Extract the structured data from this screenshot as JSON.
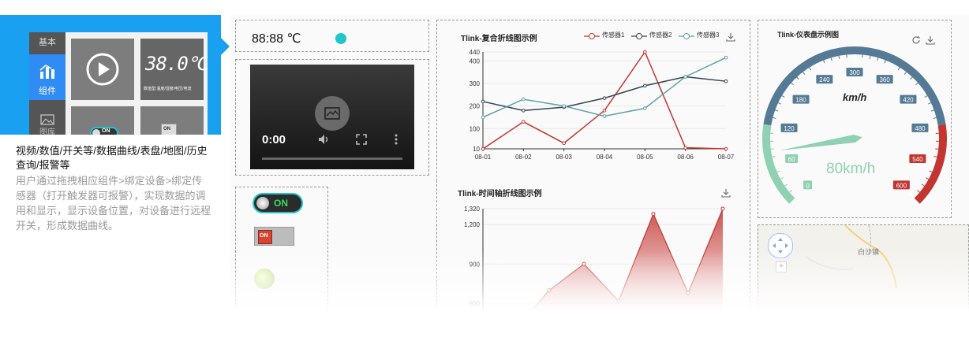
{
  "palette": {
    "tab_basic": "基本",
    "tab_components": "组件",
    "tab_images": "图库",
    "tile_digital_value": "38.0℃",
    "tile_digital_caption": "数值型:温度/湿度/电压/电流",
    "tile_switch_label": "ON",
    "tile_toggle_label": "ON"
  },
  "description": {
    "title": "视频/数值/开关等/数据曲线/表盘/地图/历史查询/报警等",
    "body": "用户通过拖拽相应组件>绑定设备>绑定传感器（打开触发器可报警），实现数据的调用和显示，显示设备位置，对设备进行远程开关，形成数据曲线。"
  },
  "temperature_widget": {
    "value": "88:88 ℃",
    "indicator_color": "#1fc6cc"
  },
  "video_player": {
    "time": "0:00"
  },
  "switch_widget": {
    "label": "ON"
  },
  "red_switch": {
    "label": "ON"
  },
  "chart_data": [
    {
      "type": "line",
      "title": "Tlink-复合折线图示例",
      "categories": [
        "08-01",
        "08-02",
        "08-03",
        "08-04",
        "08-05",
        "08-06",
        "08-07"
      ],
      "series": [
        {
          "name": "传感器1",
          "color": "#c23531",
          "values": [
            10,
            130,
            35,
            180,
            440,
            15,
            10
          ]
        },
        {
          "name": "传感器2",
          "color": "#2f4554",
          "values": [
            220,
            180,
            195,
            235,
            290,
            330,
            310
          ]
        },
        {
          "name": "传感器3",
          "color": "#61a0a8",
          "values": [
            150,
            230,
            200,
            155,
            190,
            330,
            415
          ]
        }
      ],
      "yticks": [
        10,
        100,
        200,
        300,
        400,
        440
      ],
      "ylim": [
        10,
        440
      ]
    },
    {
      "type": "area",
      "title": "Tlink-时间轴折线图示例",
      "series": [
        {
          "name": "",
          "color": "#c23531",
          "values": [
            400,
            700,
            900,
            620,
            1280,
            680,
            1320
          ]
        }
      ],
      "yticks": [
        600,
        900,
        1200,
        1320
      ],
      "ylim": [
        400,
        1320
      ]
    }
  ],
  "gauge": {
    "title": "Tlink-仪表盘示例图",
    "unit": "km/h",
    "value": 80,
    "value_text": "80km/h",
    "max": 600,
    "ticks": [
      "0",
      "60",
      "120",
      "180",
      "240",
      "300",
      "360",
      "420",
      "480",
      "540",
      "600"
    ],
    "colors": {
      "low": "#8fd1b2",
      "mid": "#557a95",
      "high": "#c23531"
    }
  },
  "map": {
    "place_label": "白沙镇",
    "zoom_in": "+"
  }
}
